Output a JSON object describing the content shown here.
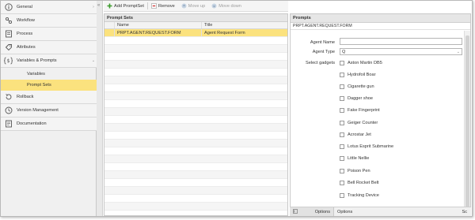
{
  "sidebar": {
    "items": [
      {
        "label": "General",
        "icon": "info-icon"
      },
      {
        "label": "Workflow",
        "icon": "workflow-icon"
      },
      {
        "label": "Process",
        "icon": "process-icon"
      },
      {
        "label": "Attributes",
        "icon": "attributes-icon"
      },
      {
        "label": "Variables & Prompts",
        "icon": "variables-icon"
      },
      {
        "label": "Rollback",
        "icon": "rollback-icon"
      },
      {
        "label": "Version Management",
        "icon": "version-icon"
      },
      {
        "label": "Documentation",
        "icon": "documentation-icon"
      }
    ],
    "sub_items": [
      {
        "label": "Variables"
      },
      {
        "label": "Prompt Sets"
      }
    ],
    "collapse_glyph": "«",
    "chevron_right": "›",
    "chevron_down": "⌄"
  },
  "toolbar": {
    "add_label": "Add PromptSet",
    "remove_label": "Remove",
    "move_up_label": "Move up",
    "move_down_label": "Move down"
  },
  "grid": {
    "title": "Prompt Sets",
    "columns": [
      "Name",
      "Title"
    ],
    "rows": [
      {
        "name": "PRPT.AGENT.REQUEST.FORM",
        "title": "Agent Request Form"
      }
    ]
  },
  "prompts": {
    "title": "Prompts",
    "subtitle": "PRPT.AGENT.REQUEST.FORM",
    "agent_name_label": "Agent Name",
    "agent_name_value": "",
    "agent_type_label": "Agent Type",
    "agent_type_value": "Q",
    "select_gadgets_label": "Select gadgets",
    "gadgets": [
      "Aston Martin DB5",
      "Hydrofoil Boar",
      "Cigarette gun",
      "Dagger shoe",
      "Fake Fingerprint",
      "Geiger Counter",
      "Acrostar Jet",
      "Lotus Esprit Submarine",
      "Little Nellie",
      "Poison Pen",
      "Bell Rocket Belt",
      "Tracking Device"
    ]
  },
  "bottom_bar": {
    "options_button": "Options",
    "options_text": "Options",
    "shortcut": "Sc"
  },
  "colors": {
    "accent_yellow": "#fbe27e",
    "add_icon_green": "#3a9a2a",
    "remove_icon_red": "#cc3333"
  }
}
